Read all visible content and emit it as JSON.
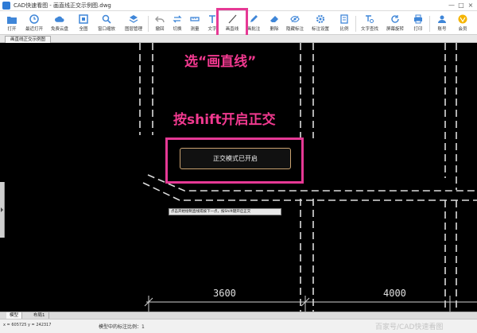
{
  "window": {
    "title": "CAD快速看图 - 画直线正交示例图.dwg",
    "minimize": "—",
    "maximize": "□",
    "close": "×"
  },
  "toolbar": {
    "items": [
      {
        "label": "打开",
        "icon": "folder-icon"
      },
      {
        "label": "最近打开",
        "icon": "clock-icon"
      },
      {
        "label": "免费云盘",
        "icon": "cloud-icon"
      },
      {
        "label": "全图",
        "icon": "fit-all-icon"
      },
      {
        "label": "窗口缩放",
        "icon": "zoom-window-icon"
      },
      {
        "label": "图层管理",
        "icon": "layers-icon"
      },
      {
        "label": "撤回",
        "icon": "undo-icon"
      },
      {
        "label": "切换",
        "icon": "switch-icon"
      },
      {
        "label": "测量",
        "icon": "ruler-icon"
      },
      {
        "label": "文字",
        "icon": "text-icon"
      },
      {
        "label": "画直线",
        "icon": "line-icon"
      },
      {
        "label": "画批注",
        "icon": "pen-icon"
      },
      {
        "label": "删除",
        "icon": "eraser-icon"
      },
      {
        "label": "隐藏标注",
        "icon": "eye-icon"
      },
      {
        "label": "标注设置",
        "icon": "settings-icon"
      },
      {
        "label": "比例",
        "icon": "scale-icon"
      },
      {
        "label": "文字查找",
        "icon": "find-text-icon"
      },
      {
        "label": "屏幕旋转",
        "icon": "rotate-icon"
      },
      {
        "label": "打印",
        "icon": "print-icon"
      },
      {
        "label": "账号",
        "icon": "user-icon"
      },
      {
        "label": "会员",
        "icon": "vip-icon"
      }
    ]
  },
  "document_tab": "画直线正交示例图",
  "annotations": {
    "step1": "选“画直线”",
    "step2": "按shift开启正交"
  },
  "ortho_mode_message": "正交模式已开启",
  "tooltip_text": "点击开始绘制直线或按下一点，按Shift键开启正交",
  "dimensions": {
    "left": "3600",
    "right": "4000"
  },
  "model_tabs": [
    "模型",
    "布局1"
  ],
  "status": {
    "coords": "x = 605725 y = 242317",
    "scale": "模型中的标注比例：1",
    "watermark": "百家号/CAD快速看图"
  },
  "colors": {
    "highlight": "#e63995",
    "annotation_text": "#f1398f",
    "mode_border": "#c9a270"
  }
}
